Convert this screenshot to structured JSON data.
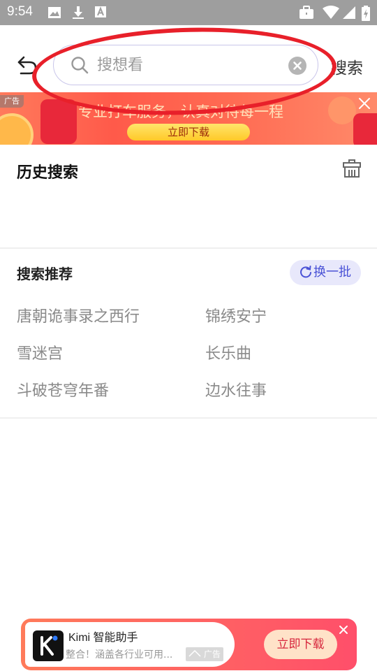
{
  "status_bar": {
    "time": "9:54",
    "left_icons": [
      "image-icon",
      "download-icon",
      "a-icon"
    ],
    "right_icons": [
      "briefcase-icon",
      "wifi-icon",
      "signal-icon",
      "battery-icon"
    ]
  },
  "header": {
    "search_placeholder": "搜想看",
    "search_label": "搜索"
  },
  "banner_ad": {
    "tag": "广告",
    "slogan": "专业打车服务，认真对待每一程",
    "button": "立即下载"
  },
  "history": {
    "title": "历史搜索"
  },
  "recommend": {
    "title": "搜索推荐",
    "refresh_label": "换一批",
    "items": [
      "唐朝诡事录之西行",
      "锦绣安宁",
      "雪迷宫",
      "长乐曲",
      "斗破苍穹年番",
      "边水往事"
    ]
  },
  "bottom_ad": {
    "app_name": "Kimi 智能助手",
    "desc": "整合！涵盖各行业可用...",
    "tag": "广告",
    "button": "立即下载"
  },
  "colors": {
    "accent": "#4a52d6",
    "annotation_red": "#e8202a",
    "ad_red": "#ff5a4a"
  }
}
